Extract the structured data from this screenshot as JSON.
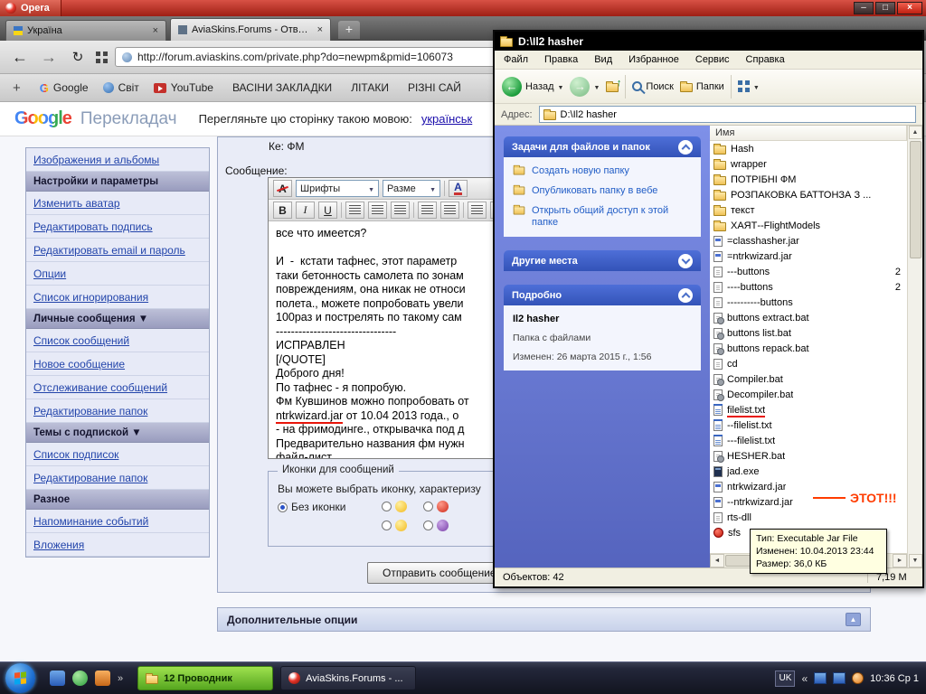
{
  "colors": {
    "opera_red": "#b03224",
    "xp_panel_blue": "#7285d8",
    "annotation_red": "#ff3c00",
    "tooltip_bg": "#ffffe1",
    "active_task_green": "#6cc024"
  },
  "opera": {
    "logo": "Opera",
    "tabs": [
      {
        "label": "Україна"
      },
      {
        "label": "AviaSkins.Forums - Ответит"
      }
    ],
    "url": "http://forum.aviaskins.com/private.php?do=newpm&pmid=106073",
    "bookmarks": [
      {
        "label": "",
        "icon": "plus"
      },
      {
        "label": "Google",
        "icon": "google"
      },
      {
        "label": "Світ",
        "icon": "globe"
      },
      {
        "label": "YouTube",
        "icon": "youtube"
      },
      {
        "label": "ВАСІНИ ЗАКЛАДКИ",
        "icon": "folder"
      },
      {
        "label": "ЛІТАКИ",
        "icon": "folder"
      },
      {
        "label": "РІЗНІ САЙ",
        "icon": "folder"
      }
    ],
    "translate": {
      "logo": "Google",
      "logo2": "Перекладач",
      "text": "Перегляньте цю сторінку такою мовою:",
      "link": "українськ"
    }
  },
  "forum": {
    "subject": "Ке: ФМ",
    "message_label": "Сообщение:",
    "sidebar": [
      {
        "label": "Изображения и альбомы",
        "type": "link"
      },
      {
        "label": "Настройки и параметры",
        "type": "header"
      },
      {
        "label": "Изменить аватар",
        "type": "link"
      },
      {
        "label": "Редактировать подпись",
        "type": "link"
      },
      {
        "label": "Редактировать email и пароль",
        "type": "link"
      },
      {
        "label": "Опции",
        "type": "link"
      },
      {
        "label": "Список игнорирования",
        "type": "link"
      },
      {
        "label": "Личные сообщения ▼",
        "type": "header"
      },
      {
        "label": "Список сообщений",
        "type": "link"
      },
      {
        "label": "Новое сообщение",
        "type": "link"
      },
      {
        "label": "Отслеживание сообщений",
        "type": "link"
      },
      {
        "label": "Редактирование папок",
        "type": "link"
      },
      {
        "label": "Темы с подпиской ▼",
        "type": "header"
      },
      {
        "label": "Список подписок",
        "type": "link"
      },
      {
        "label": "Редактирование папок",
        "type": "link"
      },
      {
        "label": "Разное",
        "type": "header"
      },
      {
        "label": "Напоминание событий",
        "type": "link"
      },
      {
        "label": "Вложения",
        "type": "link"
      }
    ],
    "editor": {
      "font_select": "Шрифты",
      "size_select": "Разме",
      "bold": "B",
      "italic": "I",
      "underline": "U"
    },
    "message_lines": [
      {
        "pre": "все что имеется?"
      },
      {
        "pre": ""
      },
      {
        "pre": "И  -  кстати тафнес, этот параметр"
      },
      {
        "pre": "таки бетонность самолета по зонам"
      },
      {
        "pre": "повреждениям, она никак не относи"
      },
      {
        "pre": "полета., можете попробовать увели"
      },
      {
        "pre": "100раз и пострелять по такому сам"
      },
      {
        "pre": "--------------------------------"
      },
      {
        "pre": "ИСПРАВЛЕН"
      },
      {
        "pre": "[/QUOTE]"
      },
      {
        "pre": "Доброго дня!"
      },
      {
        "pre": "По тафнес - я попробую."
      },
      {
        "pre": "Фм Кувшинов можно попробовать от"
      },
      {
        "marked": "ntrkwizard.jar",
        "post": " от 10.04 2013 года., о"
      },
      {
        "pre": "- на фримодинге., открывачка под д"
      },
      {
        "pre": "Предварительно названия фм нужн"
      },
      {
        "marked": "файл-лист."
      }
    ],
    "icons_box": {
      "legend": "Иконки для сообщений",
      "hint": "Вы можете выбрать иконку, характеризу",
      "no_icon": "Без иконки"
    },
    "submit": "Отправить сообщение",
    "additional": "Дополнительные опции"
  },
  "explorer": {
    "title": "D:\\Il2 hasher",
    "menus": [
      "Файл",
      "Правка",
      "Вид",
      "Избранное",
      "Сервис",
      "Справка"
    ],
    "toolbar": {
      "back": "Назад",
      "search": "Поиск",
      "folders": "Папки"
    },
    "address_label": "Адрес:",
    "address_value": "D:\\Il2 hasher",
    "tasks": {
      "header": "Задачи для файлов и папок",
      "items": [
        "Создать новую папку",
        "Опубликовать папку в вебе",
        "Открыть общий доступ к этой папке"
      ]
    },
    "other_places": "Другие места",
    "details": {
      "header": "Подробно",
      "name": "Il2 hasher",
      "type": "Папка с файлами",
      "modified": "Изменен: 26 марта 2015 г., 1:56"
    },
    "column": "Имя",
    "files": [
      {
        "name": "Hash",
        "icon": "folder"
      },
      {
        "name": "wrapper",
        "icon": "folder"
      },
      {
        "name": "ПОТРІБНІ ФМ",
        "icon": "folder"
      },
      {
        "name": "РОЗПАКОВКА БАТТОНЗА З ...",
        "icon": "folder"
      },
      {
        "name": "текст",
        "icon": "folder"
      },
      {
        "name": "ХАЯТ--FlightModels",
        "icon": "folder"
      },
      {
        "name": "=classhasher.jar",
        "icon": "jar"
      },
      {
        "name": "=ntrkwizard.jar",
        "icon": "jar"
      },
      {
        "name": "---buttons",
        "icon": "file",
        "size": "2"
      },
      {
        "name": "----buttons",
        "icon": "file",
        "size": "2"
      },
      {
        "name": "----------buttons",
        "icon": "file"
      },
      {
        "name": "buttons extract.bat",
        "icon": "bat"
      },
      {
        "name": "buttons list.bat",
        "icon": "bat"
      },
      {
        "name": "buttons repack.bat",
        "icon": "bat"
      },
      {
        "name": "cd",
        "icon": "file"
      },
      {
        "name": "Compiler.bat",
        "icon": "bat"
      },
      {
        "name": "Decompiler.bat",
        "icon": "bat"
      },
      {
        "name": "filelist.txt",
        "icon": "txt",
        "mark": "underline"
      },
      {
        "name": "--filelist.txt",
        "icon": "txt"
      },
      {
        "name": "---filelist.txt",
        "icon": "txt"
      },
      {
        "name": "HESHER.bat",
        "icon": "bat"
      },
      {
        "name": "jad.exe",
        "icon": "exe"
      },
      {
        "name": "ntrkwizard.jar",
        "icon": "jar"
      },
      {
        "name": "--ntrkwizard.jar",
        "icon": "jar",
        "mark": "arrow"
      },
      {
        "name": "rts-dll",
        "icon": "file"
      },
      {
        "name": "sfs",
        "icon": "sfs"
      }
    ],
    "tooltip": [
      "Тип: Executable Jar File",
      "Изменен: 10.04.2013 23:44",
      "Размер: 36,0 КБ"
    ],
    "status_left": "Объектов: 42",
    "status_right": "7,19 М",
    "annotation": "ЭТОТ!!!"
  },
  "taskbar": {
    "tasks": [
      {
        "label": "12 Проводник",
        "active": true
      },
      {
        "label": "AviaSkins.Forums - ..."
      }
    ],
    "tray": {
      "lang": "UK",
      "clock": "10:36 Ср 1"
    }
  }
}
